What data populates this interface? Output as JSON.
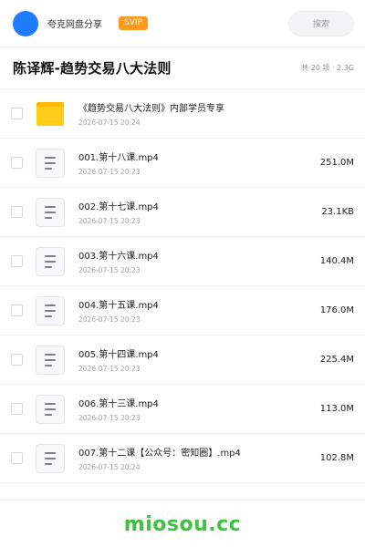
{
  "header": {
    "brand": "夸克网盘分享",
    "badge": "SVIP",
    "search_label": "搜索"
  },
  "folder": {
    "title": "陈译辉-趋势交易八大法则",
    "meta": "共 20 项 · 2.3G"
  },
  "items": [
    {
      "icon": "folder-icon",
      "name": "《趋势交易八大法则》内部学员专享",
      "date": "2026-07-15 20:24",
      "size": ""
    },
    {
      "icon": "document-icon",
      "name": "001.第十八课.mp4",
      "date": "2026-07-15 20:23",
      "size": "251.0M"
    },
    {
      "icon": "document-icon",
      "name": "002.第十七课.mp4",
      "date": "2026-07-15 20:23",
      "size": "23.1KB"
    },
    {
      "icon": "document-icon",
      "name": "003.第十六课.mp4",
      "date": "2026-07-15 20:23",
      "size": "140.4M"
    },
    {
      "icon": "document-icon",
      "name": "004.第十五课.mp4",
      "date": "2026-07-15 20:23",
      "size": "176.0M"
    },
    {
      "icon": "document-icon",
      "name": "005.第十四课.mp4",
      "date": "2026-07-15 20:23",
      "size": "225.4M"
    },
    {
      "icon": "document-icon",
      "name": "006.第十三课.mp4",
      "date": "2026-07-15 20:23",
      "size": "113.0M"
    },
    {
      "icon": "document-icon",
      "name": "007.第十二课【公众号：密知圈】.mp4",
      "date": "2026-07-15 20:24",
      "size": "102.8M"
    }
  ],
  "watermark": "miosou.cc",
  "colors": {
    "avatar": "#1f7bff",
    "badge": "#ff9a1f",
    "folder": "#ffcc1a",
    "watermark": "#3fc23f"
  }
}
